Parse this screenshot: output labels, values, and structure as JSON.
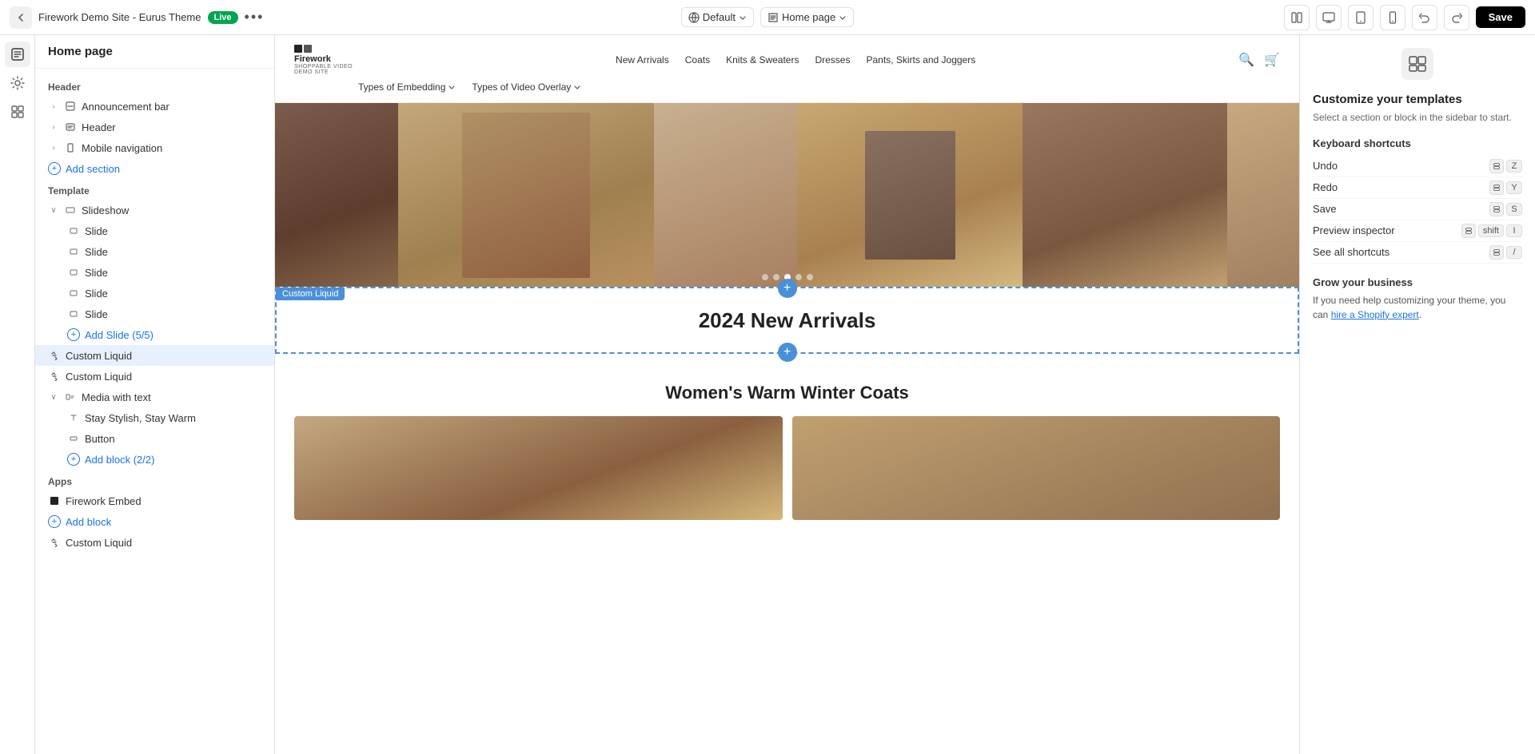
{
  "topbar": {
    "back_label": "←",
    "site_name": "Firework Demo Site - Eurus Theme",
    "live_badge": "Live",
    "more_icon": "•••",
    "default_label": "Default",
    "page_label": "Home page",
    "save_label": "Save"
  },
  "iconbar": {
    "items": [
      "pages",
      "settings",
      "blocks",
      "layers"
    ]
  },
  "sidebar": {
    "title": "Home page",
    "header_label": "Header",
    "items": [
      {
        "label": "Announcement bar",
        "level": 1,
        "icon": "announcement",
        "has_chevron": true
      },
      {
        "label": "Header",
        "level": 1,
        "icon": "header",
        "has_chevron": true
      },
      {
        "label": "Mobile navigation",
        "level": 1,
        "icon": "mobile",
        "has_chevron": true
      }
    ],
    "add_section_label": "Add section",
    "template_label": "Template",
    "template_items": [
      {
        "label": "Slideshow",
        "level": 1,
        "expanded": true,
        "icon": "slideshow"
      },
      {
        "label": "Slide",
        "level": 2,
        "icon": "slide"
      },
      {
        "label": "Slide",
        "level": 2,
        "icon": "slide"
      },
      {
        "label": "Slide",
        "level": 2,
        "icon": "slide"
      },
      {
        "label": "Slide",
        "level": 2,
        "icon": "slide"
      },
      {
        "label": "Slide",
        "level": 2,
        "icon": "slide"
      },
      {
        "label": "Add Slide (5/5)",
        "level": 2,
        "icon": "add",
        "is_add": true
      },
      {
        "label": "Custom Liquid",
        "level": 1,
        "icon": "liquid",
        "active": true
      },
      {
        "label": "Custom Liquid",
        "level": 1,
        "icon": "liquid"
      },
      {
        "label": "Media with text",
        "level": 1,
        "expanded": true,
        "icon": "media"
      },
      {
        "label": "Stay Stylish, Stay Warm",
        "level": 2,
        "icon": "text"
      },
      {
        "label": "Button",
        "level": 2,
        "icon": "button"
      },
      {
        "label": "Add block (2/2)",
        "level": 2,
        "icon": "add",
        "is_add": true
      }
    ],
    "apps_label": "Apps",
    "apps_items": [
      {
        "label": "Firework Embed",
        "level": 1,
        "icon": "firework"
      },
      {
        "label": "Add block",
        "level": 1,
        "icon": "add",
        "is_add": true
      }
    ],
    "bottom_items": [
      {
        "label": "Custom Liquid",
        "level": 1,
        "icon": "liquid"
      }
    ]
  },
  "preview": {
    "nav": {
      "logo_name": "Firework",
      "logo_sub": "SHOPPABLE VIDEO DEMO SITE",
      "links": [
        "New Arrivals",
        "Coats",
        "Knits & Sweaters",
        "Dresses",
        "Pants, Skirts and Joggers"
      ],
      "dropdowns": [
        "Types of Embedding",
        "Types of Video Overlay"
      ]
    },
    "slideshow": {
      "dots": 5,
      "active_dot": 2
    },
    "custom_liquid": {
      "label": "Custom Liquid",
      "title": "2024 New Arrivals"
    },
    "women_section": {
      "title": "Women's Warm Winter Coats"
    }
  },
  "right_panel": {
    "title": "Customize your templates",
    "desc": "Select a section or block in the sidebar to start.",
    "shortcuts_title": "Keyboard shortcuts",
    "shortcuts": [
      {
        "label": "Undo",
        "keys": [
          "⌘",
          "Z"
        ]
      },
      {
        "label": "Redo",
        "keys": [
          "⌘",
          "Y"
        ]
      },
      {
        "label": "Save",
        "keys": [
          "⌘",
          "S"
        ]
      },
      {
        "label": "Preview inspector",
        "keys": [
          "⌘",
          "shift",
          "I"
        ]
      },
      {
        "label": "See all shortcuts",
        "keys": [
          "⌘",
          "/"
        ]
      }
    ],
    "grow_title": "Grow your business",
    "grow_desc": "If you need help customizing your theme, you can ",
    "grow_link": "hire a Shopify expert",
    "grow_suffix": "."
  }
}
